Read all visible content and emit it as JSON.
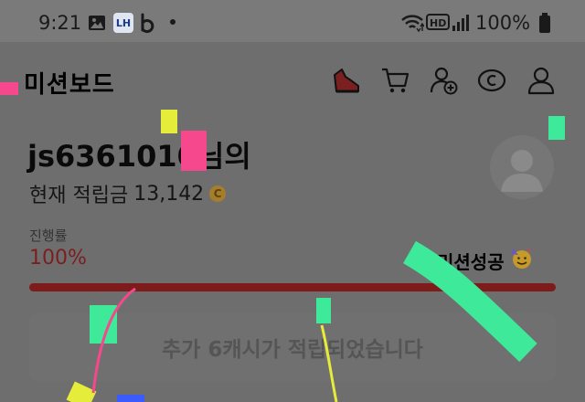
{
  "status_bar": {
    "time": "9:21",
    "icons": [
      "gallery-icon",
      "lh-app-icon",
      "b-app-icon",
      "dot-icon",
      "wifi-icon",
      "hd-icon",
      "signal-icon",
      "battery-icon"
    ],
    "lh_label": "LH",
    "hd_label": "HD",
    "battery": "100%"
  },
  "header": {
    "title": "미션보드",
    "icons": [
      "sneaker-icon",
      "cart-icon",
      "add-user-icon",
      "coin-c-icon",
      "profile-icon"
    ]
  },
  "user": {
    "name": "js6361010",
    "name_suffix": "님의",
    "points_label": "현재 적립금",
    "points": "13,142",
    "coin_symbol": "C"
  },
  "progress": {
    "label": "진행률",
    "value": "100%",
    "percent": 100,
    "status": "미션성공",
    "status_emoji": "🥳"
  },
  "banner": {
    "text": "추가 6캐시가 적립되었습니다"
  },
  "colors": {
    "overlay_background": "#6e6e6e",
    "progress_fill": "#7e1c1c",
    "progress_value": "#7a1f1f",
    "confetti_green": "#3ee99a",
    "confetti_pink": "#f5488d",
    "confetti_yellow": "#e6ec3a",
    "confetti_blue": "#3b5bff"
  }
}
